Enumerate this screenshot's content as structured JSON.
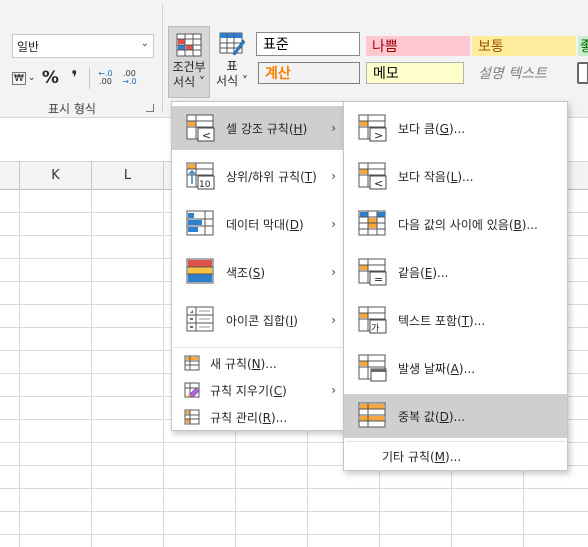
{
  "number_group": {
    "format_value": "일반",
    "group_label": "표시 형식",
    "currency_symbol": "₩",
    "percent_symbol": "%",
    "comma_symbol": "❜",
    "increase_decimal_top": "←.0",
    "increase_decimal_bottom": ".00",
    "decrease_decimal_top": ".00",
    "decrease_decimal_bottom": "→.0"
  },
  "styles_group": {
    "conditional_formatting": {
      "line1": "조건부",
      "line2": "서식 ˅"
    },
    "format_as_table": {
      "line1": "표",
      "line2": "서식 ˅"
    },
    "cell_styles": [
      {
        "label": "표준",
        "bg": "#ffffff",
        "color": "#000000",
        "border": "#8a8a8a"
      },
      {
        "label": "나쁨",
        "bg": "#ffc7ce",
        "color": "#9c0006",
        "border": "#ffc7ce"
      },
      {
        "label": "보통",
        "bg": "#ffeb9c",
        "color": "#9c5700",
        "border": "#ffeb9c"
      },
      {
        "label": "좋",
        "bg": "#c6efce",
        "color": "#006100",
        "border": "#c6efce"
      },
      {
        "label": "계산",
        "bg": "#f2f2f2",
        "color": "#fa7d00",
        "border": "#7f7f7f"
      },
      {
        "label": "메모",
        "bg": "#ffffcc",
        "color": "#000000",
        "border": "#b2b2b2"
      },
      {
        "label": "설명 텍스트",
        "bg": "#f3f3f3",
        "color": "#7f7f7f",
        "border": "#f3f3f3"
      }
    ]
  },
  "sheet": {
    "columns": [
      "K",
      "L"
    ]
  },
  "cf_menu": {
    "items": [
      {
        "label": "셀 강조 규칙",
        "key": "H",
        "icon": "highlight-cells-rules-icon",
        "submenu": true,
        "highlighted": true
      },
      {
        "label": "상위/하위 규칙",
        "key": "T",
        "icon": "top-bottom-rules-icon",
        "submenu": true,
        "highlighted": false
      },
      {
        "label": "데이터 막대",
        "key": "D",
        "icon": "data-bars-icon",
        "submenu": true,
        "highlighted": false
      },
      {
        "label": "색조",
        "key": "S",
        "icon": "color-scales-icon",
        "submenu": true,
        "highlighted": false
      },
      {
        "label": "아이콘 집합",
        "key": "I",
        "icon": "icon-sets-icon",
        "submenu": true,
        "highlighted": false
      }
    ],
    "small_items": [
      {
        "label": "새 규칙",
        "key": "N",
        "suffix": "...",
        "icon": "new-rule-icon",
        "submenu": false
      },
      {
        "label": "규칙 지우기",
        "key": "C",
        "suffix": "",
        "icon": "clear-rules-icon",
        "submenu": true
      },
      {
        "label": "규칙 관리",
        "key": "R",
        "suffix": "...",
        "icon": "manage-rules-icon",
        "submenu": false
      }
    ]
  },
  "highlight_submenu": {
    "items": [
      {
        "label": "보다 큼",
        "key": "G",
        "icon": "greater-than-icon",
        "glyph": ">"
      },
      {
        "label": "보다 작음",
        "key": "L",
        "icon": "less-than-icon",
        "glyph": "<"
      },
      {
        "label": "다음 값의 사이에 있음",
        "key": "B",
        "icon": "between-icon",
        "glyph": ""
      },
      {
        "label": "같음",
        "key": "E",
        "icon": "equal-to-icon",
        "glyph": "="
      },
      {
        "label": "텍스트 포함",
        "key": "T",
        "icon": "text-contains-icon",
        "glyph": "가"
      },
      {
        "label": "발생 날짜",
        "key": "A",
        "icon": "date-occurring-icon",
        "glyph": ""
      },
      {
        "label": "중복 값",
        "key": "D",
        "icon": "duplicate-values-icon",
        "glyph": ""
      }
    ],
    "more_rules": {
      "label": "기타 규칙",
      "key": "M",
      "suffix": "..."
    }
  },
  "colors": {
    "menu_highlight": "#cfcfcf",
    "icon_orange": "#f5a742",
    "icon_blue": "#2f7fd0",
    "icon_red": "#e0514b"
  }
}
